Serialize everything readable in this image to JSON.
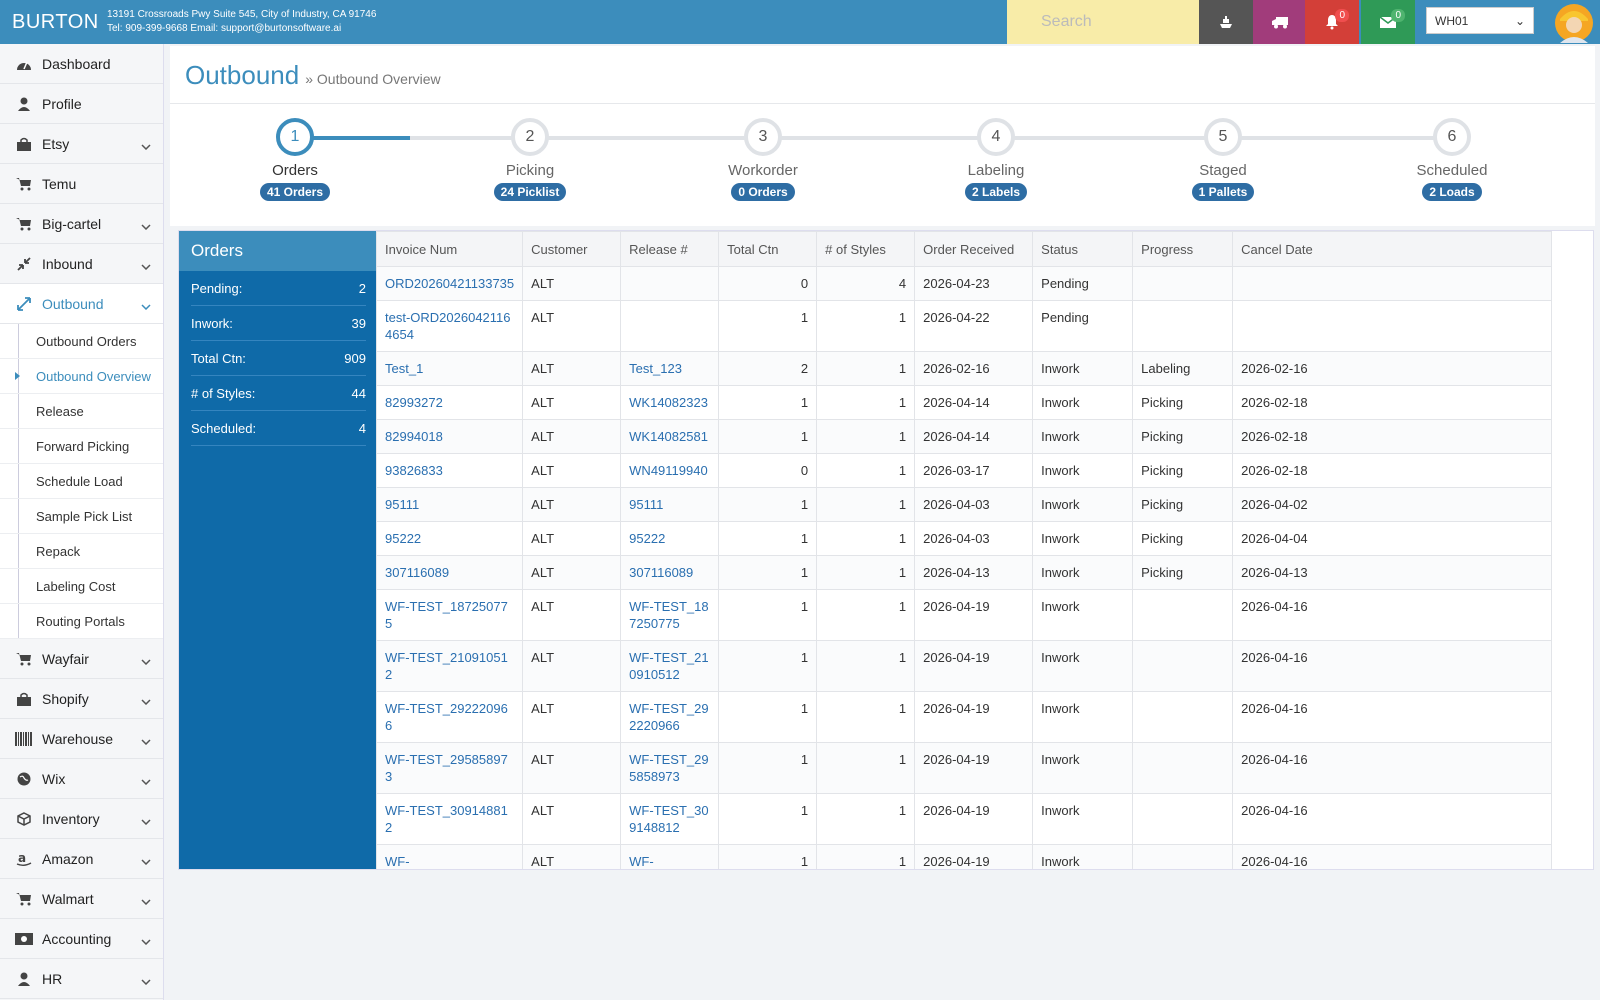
{
  "header": {
    "brand": "BURTON",
    "address": "13191 Crossroads Pwy Suite 545, City of Industry, CA 91746",
    "contact": "Tel: 909-399-9668 Email: support@burtonsoftware.ai",
    "search_placeholder": "Search",
    "notifications_count": "0",
    "messages_count": "0",
    "warehouse": "WH01"
  },
  "sidebar": {
    "top": [
      {
        "label": "Dashboard",
        "icon": "dashboard-icon"
      },
      {
        "label": "Profile",
        "icon": "user-icon"
      },
      {
        "label": "Etsy",
        "icon": "shopping-bag-icon"
      },
      {
        "label": "Temu",
        "icon": "cart-icon"
      },
      {
        "label": "Big-cartel",
        "icon": "cart-icon"
      },
      {
        "label": "Inbound",
        "icon": "compress-icon"
      },
      {
        "label": "Outbound",
        "icon": "expand-icon"
      }
    ],
    "sub": [
      "Outbound Orders",
      "Outbound Overview",
      "Release",
      "Forward Picking",
      "Schedule Load",
      "Sample Pick List",
      "Repack",
      "Labeling Cost",
      "Routing Portals"
    ],
    "bottom": [
      {
        "label": "Wayfair",
        "icon": "cart-icon"
      },
      {
        "label": "Shopify",
        "icon": "shopping-bag-icon"
      },
      {
        "label": "Warehouse",
        "icon": "barcode-icon"
      },
      {
        "label": "Wix",
        "icon": "globe-icon"
      },
      {
        "label": "Inventory",
        "icon": "cube-icon"
      },
      {
        "label": "Amazon",
        "icon": "amazon-icon"
      },
      {
        "label": "Walmart",
        "icon": "cart-icon"
      },
      {
        "label": "Accounting",
        "icon": "money-icon"
      },
      {
        "label": "HR",
        "icon": "user-icon"
      }
    ]
  },
  "page": {
    "title": "Outbound",
    "subtitle": "» Outbound Overview"
  },
  "steps": [
    {
      "num": "1",
      "label": "Orders",
      "badge": "41 Orders"
    },
    {
      "num": "2",
      "label": "Picking",
      "badge": "24 Picklist"
    },
    {
      "num": "3",
      "label": "Workorder",
      "badge": "0 Orders"
    },
    {
      "num": "4",
      "label": "Labeling",
      "badge": "2 Labels"
    },
    {
      "num": "5",
      "label": "Staged",
      "badge": "1 Pallets"
    },
    {
      "num": "6",
      "label": "Scheduled",
      "badge": "2 Loads"
    }
  ],
  "orders_panel": {
    "title": "Orders",
    "stats": [
      {
        "label": "Pending:",
        "value": "2"
      },
      {
        "label": "Inwork:",
        "value": "39"
      },
      {
        "label": "Total Ctn:",
        "value": "909"
      },
      {
        "label": "# of Styles:",
        "value": "44"
      },
      {
        "label": "Scheduled:",
        "value": "4"
      }
    ]
  },
  "table": {
    "headers": [
      "Invoice Num",
      "Customer",
      "Release #",
      "Total Ctn",
      "# of Styles",
      "Order Received",
      "Status",
      "Progress",
      "Cancel Date"
    ],
    "rows": [
      {
        "inv": "ORD20260421133735",
        "cus": "ALT",
        "rel": "",
        "ctn": "0",
        "sty": "4",
        "date": "2026-04-23",
        "status": "Pending",
        "prog": "",
        "cancel": ""
      },
      {
        "inv": "test-ORD20260421164654",
        "cus": "ALT",
        "rel": "",
        "ctn": "1",
        "sty": "1",
        "date": "2026-04-22",
        "status": "Pending",
        "prog": "",
        "cancel": ""
      },
      {
        "inv": "Test_1",
        "cus": "ALT",
        "rel": "Test_123",
        "ctn": "2",
        "sty": "1",
        "date": "2026-02-16",
        "status": "Inwork",
        "prog": "Labeling",
        "cancel": "2026-02-16"
      },
      {
        "inv": "82993272",
        "cus": "ALT",
        "rel": "WK14082323",
        "ctn": "1",
        "sty": "1",
        "date": "2026-04-14",
        "status": "Inwork",
        "prog": "Picking",
        "cancel": "2026-02-18"
      },
      {
        "inv": "82994018",
        "cus": "ALT",
        "rel": "WK14082581",
        "ctn": "1",
        "sty": "1",
        "date": "2026-04-14",
        "status": "Inwork",
        "prog": "Picking",
        "cancel": "2026-02-18"
      },
      {
        "inv": "93826833",
        "cus": "ALT",
        "rel": "WN49119940",
        "ctn": "0",
        "sty": "1",
        "date": "2026-03-17",
        "status": "Inwork",
        "prog": "Picking",
        "cancel": "2026-02-18"
      },
      {
        "inv": "95111",
        "cus": "ALT",
        "rel": "95111",
        "ctn": "1",
        "sty": "1",
        "date": "2026-04-03",
        "status": "Inwork",
        "prog": "Picking",
        "cancel": "2026-04-02"
      },
      {
        "inv": "95222",
        "cus": "ALT",
        "rel": "95222",
        "ctn": "1",
        "sty": "1",
        "date": "2026-04-03",
        "status": "Inwork",
        "prog": "Picking",
        "cancel": "2026-04-04"
      },
      {
        "inv": "307116089",
        "cus": "ALT",
        "rel": "307116089",
        "ctn": "1",
        "sty": "1",
        "date": "2026-04-13",
        "status": "Inwork",
        "prog": "Picking",
        "cancel": "2026-04-13"
      },
      {
        "inv": "WF-TEST_187250775",
        "cus": "ALT",
        "rel": "WF-TEST_187250775",
        "ctn": "1",
        "sty": "1",
        "date": "2026-04-19",
        "status": "Inwork",
        "prog": "",
        "cancel": "2026-04-16"
      },
      {
        "inv": "WF-TEST_210910512",
        "cus": "ALT",
        "rel": "WF-TEST_210910512",
        "ctn": "1",
        "sty": "1",
        "date": "2026-04-19",
        "status": "Inwork",
        "prog": "",
        "cancel": "2026-04-16"
      },
      {
        "inv": "WF-TEST_292220966",
        "cus": "ALT",
        "rel": "WF-TEST_292220966",
        "ctn": "1",
        "sty": "1",
        "date": "2026-04-19",
        "status": "Inwork",
        "prog": "",
        "cancel": "2026-04-16"
      },
      {
        "inv": "WF-TEST_295858973",
        "cus": "ALT",
        "rel": "WF-TEST_295858973",
        "ctn": "1",
        "sty": "1",
        "date": "2026-04-19",
        "status": "Inwork",
        "prog": "",
        "cancel": "2026-04-16"
      },
      {
        "inv": "WF-TEST_309148812",
        "cus": "ALT",
        "rel": "WF-TEST_309148812",
        "ctn": "1",
        "sty": "1",
        "date": "2026-04-19",
        "status": "Inwork",
        "prog": "",
        "cancel": "2026-04-16"
      },
      {
        "inv": "WF-",
        "cus": "ALT",
        "rel": "WF-",
        "ctn": "1",
        "sty": "1",
        "date": "2026-04-19",
        "status": "Inwork",
        "prog": "",
        "cancel": "2026-04-16"
      }
    ]
  },
  "colors": {
    "primary": "#3c8dbc",
    "panel": "#0f6aa8",
    "search_bg": "#f8eca8",
    "bell_bg": "#d33f38",
    "mail_bg": "#2f9a57",
    "truck_bg": "#a13c7b"
  }
}
